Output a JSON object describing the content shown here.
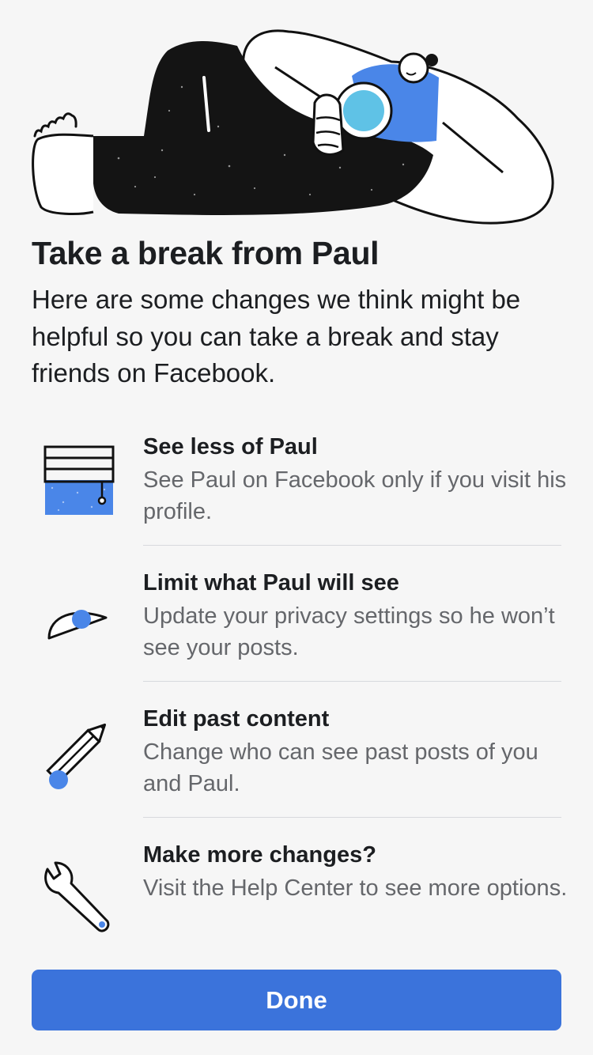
{
  "header": {
    "illustration_icon": "resting-person-illustration",
    "title": "Take a break from Paul",
    "intro": "Here are some changes we think might be helpful so you can take a break and stay friends on Facebook."
  },
  "options": [
    {
      "icon": "window-blinds-icon",
      "title": "See less of Paul",
      "description": "See Paul on Facebook only if you visit his profile."
    },
    {
      "icon": "eye-icon",
      "title": "Limit what Paul will see",
      "description": "Update your privacy settings so he won’t see your posts."
    },
    {
      "icon": "pencil-icon",
      "title": "Edit past content",
      "description": "Change who can see past posts of you and Paul."
    },
    {
      "icon": "wrench-icon",
      "title": "Make more changes?",
      "description": "Visit the Help Center to see more options."
    }
  ],
  "footer": {
    "done_label": "Done"
  },
  "colors": {
    "accent": "#3b73db",
    "illustration_blue": "#4a86e8",
    "illustration_light_blue": "#5fc2e6",
    "background": "#f6f6f6",
    "title_text": "#1c1e21",
    "secondary_text": "#65676b",
    "divider": "#d7d9dd"
  }
}
